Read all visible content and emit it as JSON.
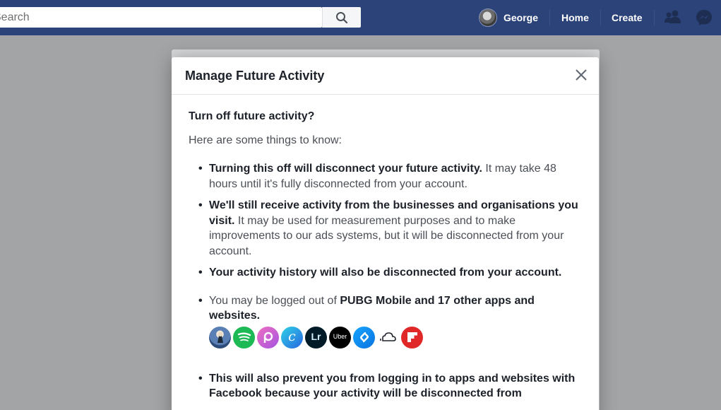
{
  "topbar": {
    "search_placeholder": "Search",
    "profile_name": "George",
    "home_label": "Home",
    "create_label": "Create"
  },
  "modal": {
    "title": "Manage Future Activity",
    "question": "Turn off future activity?",
    "intro": "Here are some things to know:",
    "points": [
      {
        "bold": "Turning this off will disconnect your future activity.",
        "rest": " It may take 48 hours until it's fully disconnected from your account."
      },
      {
        "bold": "We'll still receive activity from the businesses and organisations you visit.",
        "rest": " It may be used for measurement purposes and to make improvements to our ads systems, but it will be disconnected from your account."
      },
      {
        "bold": "Your activity history will also be disconnected from your account.",
        "rest": ""
      }
    ],
    "logout_prefix": "You may be logged out of ",
    "logout_bold": "PUBG Mobile and 17 other apps and websites.",
    "apps": [
      {
        "name": "pubg-mobile-icon",
        "color": "#3d6fb4",
        "glyph": ""
      },
      {
        "name": "spotify-icon",
        "color": "#1db954",
        "glyph": ""
      },
      {
        "name": "picsart-icon",
        "color": "#d04fc0",
        "glyph": "P"
      },
      {
        "name": "canva-icon",
        "color": "#1e8fe1",
        "glyph": "C"
      },
      {
        "name": "lightroom-icon",
        "color": "#001a27",
        "glyph": "Lr"
      },
      {
        "name": "uber-icon",
        "color": "#000000",
        "glyph": "Uber"
      },
      {
        "name": "shazam-icon",
        "color": "#0d8ef0",
        "glyph": "S"
      },
      {
        "name": "soundcloud-icon",
        "color": "#ffffff",
        "glyph": ""
      },
      {
        "name": "flipboard-icon",
        "color": "#e12828",
        "glyph": "F"
      }
    ],
    "last_point": "This will also prevent you from logging in to apps and websites with Facebook because your activity will be disconnected from"
  }
}
